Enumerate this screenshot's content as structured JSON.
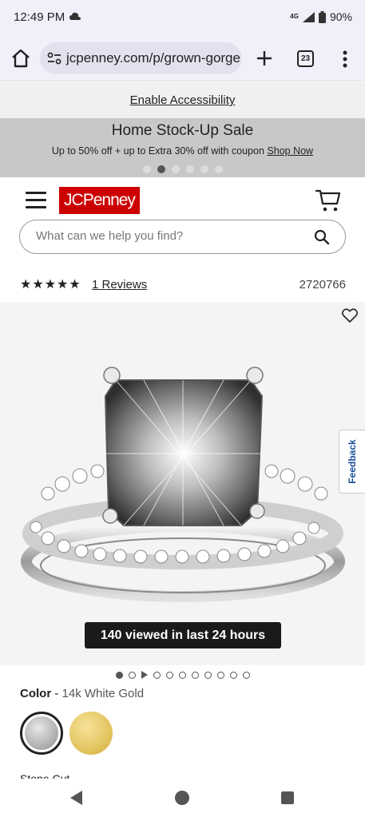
{
  "status_bar": {
    "time": "12:49 PM",
    "network": "4G",
    "battery": "90%",
    "icons": [
      "cloud-icon",
      "signal-icon",
      "battery-icon"
    ]
  },
  "browser": {
    "url": "jcpenney.com/p/grown-gorge",
    "tab_count": "23",
    "icons": [
      "home-icon",
      "site-settings-icon",
      "new-tab-icon",
      "tabs-icon",
      "more-menu-icon"
    ]
  },
  "accessibility": {
    "link": "Enable Accessibility"
  },
  "promo": {
    "title": "Home Stock-Up Sale",
    "subtitle": "Up to 50% off + up to Extra 30% off with coupon",
    "link": "Shop Now",
    "slide_count": 6,
    "active_slide": 2
  },
  "header": {
    "logo": "JCPenney",
    "search_placeholder": "What can we help you find?",
    "icons": [
      "hamburger-menu-icon",
      "cart-icon",
      "search-icon"
    ]
  },
  "product": {
    "stars": "★★★★★",
    "rating": 5,
    "reviews_link": "1 Reviews",
    "product_id": "2720766",
    "viewed_badge": "140 viewed in last 24 hours",
    "feedback_label": "Feedback",
    "image_count": 11,
    "active_image": 1
  },
  "color": {
    "label": "Color",
    "separator": " - ",
    "value": "14k White Gold",
    "swatches": [
      "White Gold",
      "Yellow Gold"
    ],
    "swatch_colors": [
      "#b4b4b4",
      "#e2c25c"
    ]
  },
  "cut_off_text": "Stone Cut"
}
